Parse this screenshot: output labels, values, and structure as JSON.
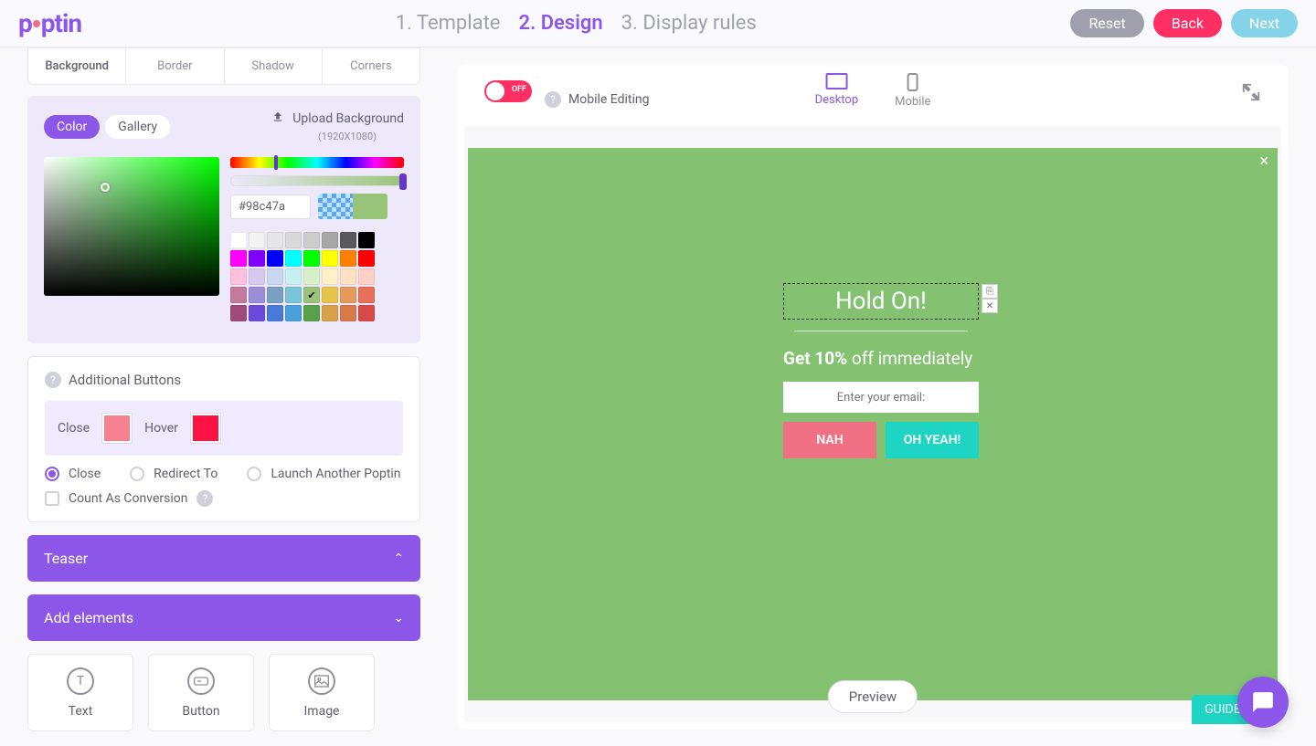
{
  "brand": {
    "name": "poptin"
  },
  "header": {
    "steps": [
      "1. Template",
      "2. Design",
      "3. Display rules"
    ],
    "active_step": 1,
    "buttons": {
      "reset": "Reset",
      "back": "Back",
      "next": "Next"
    }
  },
  "style_tabs": {
    "items": [
      "Background",
      "Border",
      "Shadow",
      "Corners"
    ],
    "active": 0
  },
  "bg_panel": {
    "pills": {
      "color": "Color",
      "gallery": "Gallery"
    },
    "upload_label": "Upload Background",
    "upload_dims": "(1920X1080)",
    "hex": "#98c47a",
    "swatches": [
      "#ffffff",
      "#f2f2f2",
      "#e6e6e6",
      "#d9d9d9",
      "#cccccc",
      "#a6a6a6",
      "#595959",
      "#000000",
      "#ff00ff",
      "#8000ff",
      "#0000ff",
      "#00ffff",
      "#00ff00",
      "#ffff00",
      "#ff8000",
      "#ff0000",
      "#ffc0e0",
      "#d8c8f0",
      "#c8d8f0",
      "#c8f0f0",
      "#d8f0c8",
      "#fff0c8",
      "#ffe0c0",
      "#ffd0c8",
      "#c47a9a",
      "#9a8ed8",
      "#7aa0c4",
      "#7ac4d8",
      "#98c47a",
      "#e6c44a",
      "#e69a5a",
      "#e6705a",
      "#a04a7a",
      "#6a4ad8",
      "#4a7ad8",
      "#4aa0d8",
      "#5aa04a",
      "#d8a04a",
      "#d87a4a",
      "#d84a4a"
    ],
    "selected_swatch": 28
  },
  "additional_buttons": {
    "title": "Additional Buttons",
    "close_label": "Close",
    "close_color": "#f78090",
    "hover_label": "Hover",
    "hover_color": "#ff1144",
    "radios": {
      "close": "Close",
      "redirect": "Redirect To",
      "launch": "Launch Another Poptin"
    },
    "selected_radio": "close",
    "conversion_label": "Count As Conversion"
  },
  "accordions": {
    "teaser": "Teaser",
    "add_elements": "Add elements"
  },
  "elements": {
    "text": {
      "label": "Text",
      "glyph": "T"
    },
    "button": {
      "label": "Button"
    },
    "image": {
      "label": "Image"
    }
  },
  "canvas": {
    "toggle_state": "OFF",
    "mobile_editing": "Mobile Editing",
    "device_tabs": {
      "desktop": "Desktop",
      "mobile": "Mobile"
    },
    "popup": {
      "title": "Hold On!",
      "sub_bold": "Get 10%",
      "sub_rest": " off immediately",
      "email_placeholder": "Enter your email:",
      "btn_nah": "NAH",
      "btn_yeah": "OH YEAH!"
    },
    "preview_label": "Preview",
    "guides_label": "GUIDES"
  }
}
